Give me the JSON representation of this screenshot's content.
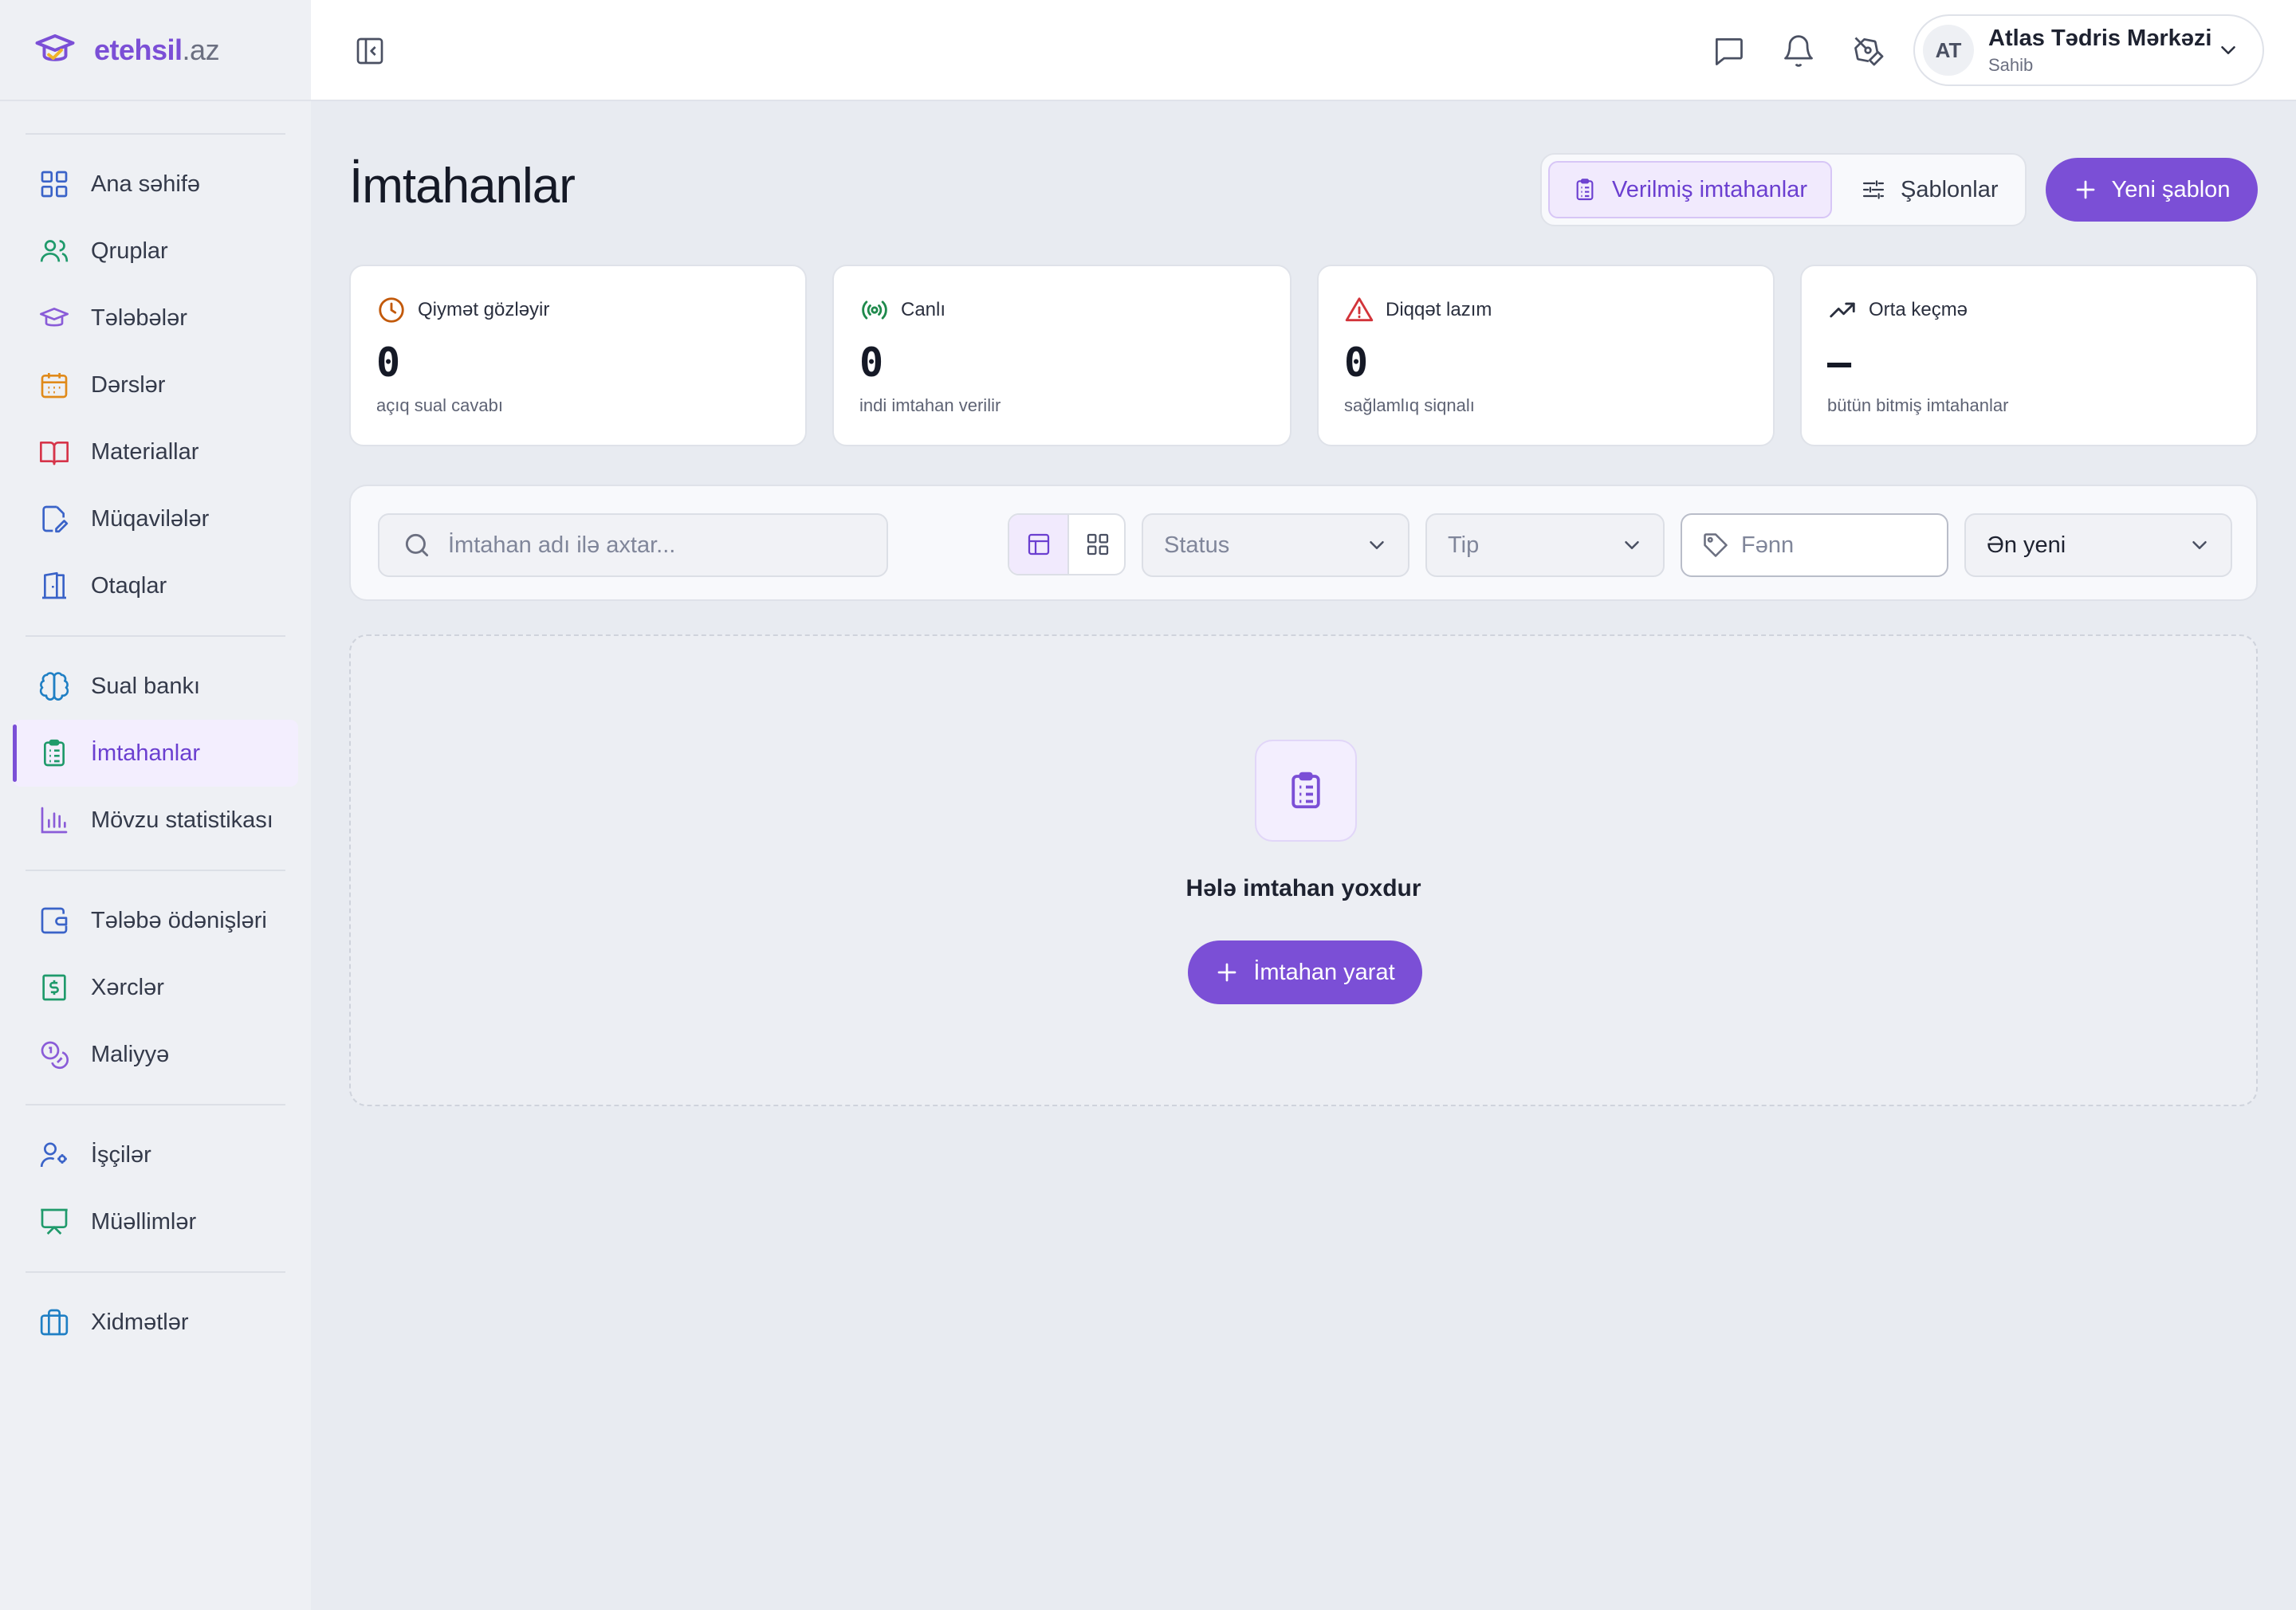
{
  "brand": {
    "name": "etehsil",
    "tld": ".az"
  },
  "sidebar": {
    "groups": [
      [
        {
          "label": "Ana səhifə",
          "icon": "grid-icon"
        },
        {
          "label": "Qruplar",
          "icon": "users-icon"
        },
        {
          "label": "Tələbələr",
          "icon": "graduation-cap-icon"
        },
        {
          "label": "Dərslər",
          "icon": "calendar-icon"
        },
        {
          "label": "Materiallar",
          "icon": "book-open-icon"
        },
        {
          "label": "Müqavilələr",
          "icon": "file-edit-icon"
        },
        {
          "label": "Otaqlar",
          "icon": "door-icon"
        }
      ],
      [
        {
          "label": "Sual bankı",
          "icon": "brain-icon"
        },
        {
          "label": "İmtahanlar",
          "icon": "clipboard-list-icon",
          "active": true
        },
        {
          "label": "Mövzu statistikası",
          "icon": "bar-chart-icon"
        }
      ],
      [
        {
          "label": "Tələbə ödənişləri",
          "icon": "wallet-icon"
        },
        {
          "label": "Xərclər",
          "icon": "receipt-dollar-icon"
        },
        {
          "label": "Maliyyə",
          "icon": "coins-icon"
        }
      ],
      [
        {
          "label": "İşçilər",
          "icon": "user-cog-icon"
        },
        {
          "label": "Müəllimlər",
          "icon": "presentation-icon"
        }
      ],
      [
        {
          "label": "Xidmətlər",
          "icon": "briefcase-icon"
        }
      ]
    ]
  },
  "topbar": {
    "account": {
      "initials": "AT",
      "name": "Atlas Tədris Mərkəzi",
      "role": "Sahib"
    }
  },
  "page": {
    "title": "İmtahanlar",
    "tabs": {
      "issued": "Verilmiş imtahanlar",
      "templates": "Şablonlar"
    },
    "new_template": "Yeni şablon"
  },
  "stats": [
    {
      "title": "Qiymət gözləyir",
      "value": "0",
      "sub": "açıq sual cavabı",
      "icon": "clock-icon",
      "color": "#c2590a"
    },
    {
      "title": "Canlı",
      "value": "0",
      "sub": "indi imtahan verilir",
      "icon": "radio-live-icon",
      "color": "#1f8a4c"
    },
    {
      "title": "Diqqət lazım",
      "value": "0",
      "sub": "sağlamlıq siqnalı",
      "icon": "warning-icon",
      "color": "#d2343a"
    },
    {
      "title": "Orta keçmə",
      "value": "—",
      "sub": "bütün bitmiş imtahanlar",
      "icon": "trending-up-icon",
      "color": "#2a2f3e"
    }
  ],
  "filters": {
    "search_placeholder": "İmtahan adı ilə axtar...",
    "status": "Status",
    "type": "Tip",
    "subject_placeholder": "Fənn",
    "sort": "Ən yeni"
  },
  "empty": {
    "title": "Hələ imtahan yoxdur",
    "button": "İmtahan yarat"
  },
  "colors": {
    "accent": "#7b4fd6"
  }
}
